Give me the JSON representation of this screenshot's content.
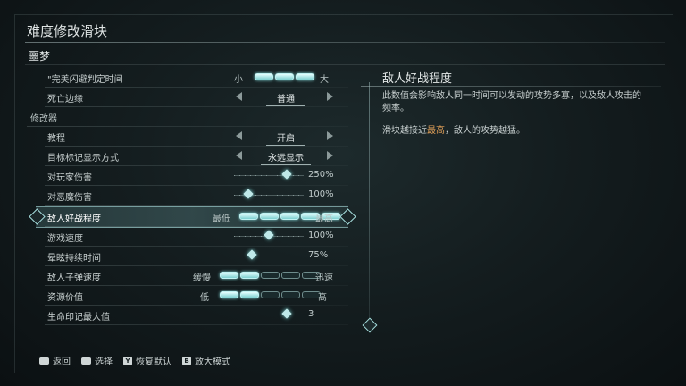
{
  "header": {
    "title": "难度修改滑块",
    "preset": "噩梦"
  },
  "rows": {
    "perfect_dodge": {
      "label": "\"完美闪避判定时间",
      "lo": "小",
      "hi": "大",
      "value_segments": 3,
      "total_segments": 3
    },
    "death_edge": {
      "label": "死亡边缘",
      "value": "普通"
    },
    "section_modifiers": {
      "label": "修改器"
    },
    "tutorial": {
      "label": "教程",
      "value": "开启"
    },
    "target_marker": {
      "label": "目标标记显示方式",
      "value": "永远显示"
    },
    "damage_to_player": {
      "label": "对玩家伤害",
      "value": "250%",
      "level": 0.75
    },
    "damage_to_demons": {
      "label": "对恶魔伤害",
      "value": "100%",
      "level": 0.2
    },
    "enemy_aggression": {
      "label": "敌人好战程度",
      "lo": "最低",
      "hi": "最高",
      "value_segments": 5,
      "total_segments": 5
    },
    "game_speed": {
      "label": "游戏速度",
      "value": "100%",
      "level": 0.5
    },
    "stun_duration": {
      "label": "晕眩持续时间",
      "value": "75%",
      "level": 0.25
    },
    "projectile_speed": {
      "label": "敌人子弹速度",
      "lo": "缓慢",
      "hi": "迅速",
      "value_segments": 2,
      "total_segments": 5
    },
    "resource_value": {
      "label": "资源价值",
      "lo": "低",
      "hi": "高",
      "value_segments": 2,
      "total_segments": 5
    },
    "life_sigil_max": {
      "label": "生命印记最大值",
      "value": "3",
      "level": 0.75
    }
  },
  "info": {
    "title": "敌人好战程度",
    "body": "此数值会影响敌人同一时间可以发动的攻势多寡，以及敌人攻击的频率。",
    "note_prefix": "滑块越接近",
    "note_highlight": "最高",
    "note_suffix": "，敌人的攻势越猛。"
  },
  "footer": {
    "back": "返回",
    "select": "选择",
    "reset": "恢复默认",
    "reset_key": "Y",
    "zoom": "放大模式",
    "zoom_key": "B"
  },
  "colors": {
    "accent": "#7ed0d0",
    "highlight": "#e8a45a"
  }
}
